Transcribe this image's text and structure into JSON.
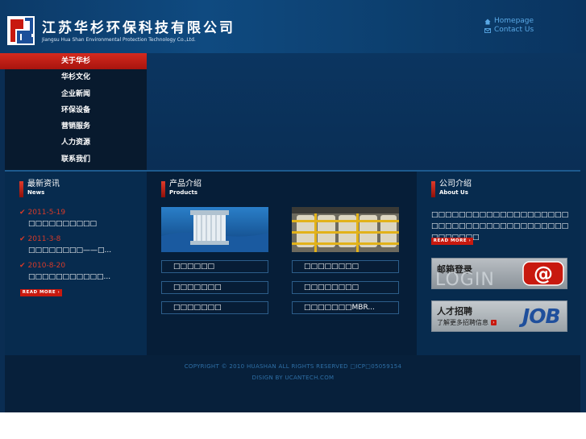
{
  "header": {
    "company_cn": "江苏华杉环保科技有限公司",
    "company_en": "Jiangsu Hua Shan Environmental Protection Technology Co.,Ltd.",
    "links": [
      {
        "label": "Homepage",
        "icon": "home-icon"
      },
      {
        "label": "Contact Us",
        "icon": "mail-icon"
      }
    ]
  },
  "nav": {
    "items": [
      "关于华杉",
      "华杉文化",
      "企业新闻",
      "环保设备",
      "营销服务",
      "人力资源",
      "联系我们"
    ],
    "active_index": 0
  },
  "news": {
    "title_cn": "最新资讯",
    "title_en": "News",
    "items": [
      {
        "date": "2011-5-19",
        "title": "□□□□□□□□□□"
      },
      {
        "date": "2011-3-8",
        "title": "□□□□□□□□——□..."
      },
      {
        "date": "2010-8-20",
        "title": "□□□□□□□□□□□..."
      }
    ],
    "read_more": "READ MORE"
  },
  "products": {
    "title_cn": "产品介绍",
    "title_en": "Products",
    "buttons": [
      [
        "□□□□□□",
        "□□□□□□□□"
      ],
      [
        "□□□□□□□",
        "□□□□□□□□"
      ],
      [
        "□□□□□□□",
        "□□□□□□□MBR..."
      ]
    ]
  },
  "about": {
    "title_cn": "公司介绍",
    "title_en": "About Us",
    "text": "□□□□□□□□□□□□□□□□□□□□□□□□□□□□□□□□□□□□□□□□□□□□□□□",
    "read_more": "READ MORE",
    "mail_login": {
      "cn": "邮箱登录",
      "en": "LOGIN"
    },
    "jobs": {
      "cn": "人才招聘",
      "sub": "了解更多招聘信息",
      "en": "JOB"
    }
  },
  "footer": {
    "copyright": "COPYRIGHT © 2010 HUASHAN ALL RIGHTS RESERVED □ICP□05059154",
    "design": "DISIGN BY UCANTECH.COM"
  },
  "colors": {
    "accent_red": "#c8190f",
    "link_blue": "#5aa9e6",
    "bg_dark": "#0a2d52"
  }
}
